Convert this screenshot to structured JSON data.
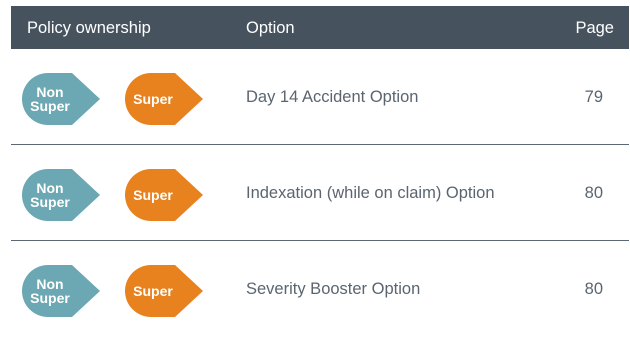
{
  "header": {
    "ownership": "Policy ownership",
    "option": "Option",
    "page": "Page"
  },
  "colors": {
    "header_bg": "#46535f",
    "non_super": "#6ba8b3",
    "super": "#e8821f",
    "divider": "#5d6875",
    "body_text": "#5a6570"
  },
  "rows": [
    {
      "non_super_label": "Non Super",
      "super_label": "Super",
      "option": "Day 14 Accident Option",
      "page": "79"
    },
    {
      "non_super_label": "Non Super",
      "super_label": "Super",
      "option": "Indexation (while on claim) Option",
      "page": "80"
    },
    {
      "non_super_label": "Non Super",
      "super_label": "Super",
      "option": "Severity Booster Option",
      "page": "80"
    }
  ]
}
